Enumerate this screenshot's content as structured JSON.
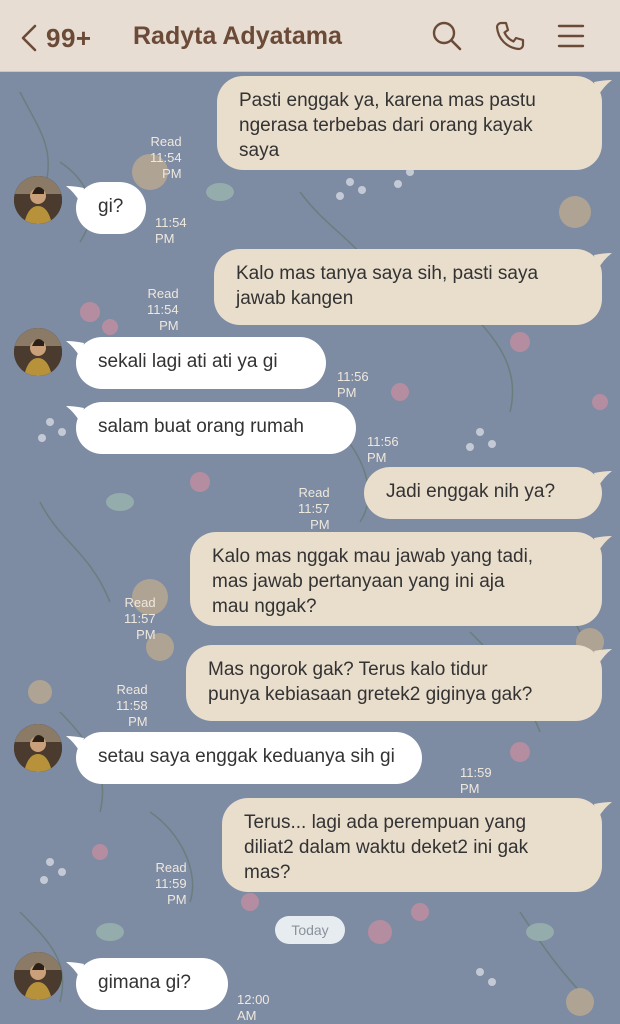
{
  "header": {
    "back_count": "99+",
    "title": "Radyta Adyatama",
    "icons": [
      "chevron-left-icon",
      "search-icon",
      "phone-icon",
      "menu-icon"
    ]
  },
  "messages": [
    {
      "side": "out",
      "lines": [
        "Pasti enggak ya, karena mas pastu",
        "ngerasa terbebas dari orang kayak",
        "saya"
      ],
      "read": "Read",
      "time": "11:54 PM"
    },
    {
      "side": "in",
      "lines": [
        "gi?"
      ],
      "time": "11:54 PM"
    },
    {
      "side": "out",
      "lines": [
        "Kalo mas tanya saya sih, pasti saya",
        "jawab kangen"
      ],
      "read": "Read",
      "time": "11:54 PM"
    },
    {
      "side": "in",
      "lines": [
        "sekali lagi ati ati ya gi"
      ],
      "time": "11:56 PM"
    },
    {
      "side": "in",
      "lines": [
        "salam buat orang rumah"
      ],
      "time": "11:56 PM"
    },
    {
      "side": "out",
      "lines": [
        "Jadi enggak nih ya?"
      ],
      "read": "Read",
      "time": "11:57 PM"
    },
    {
      "side": "out",
      "lines": [
        "Kalo mas nggak mau jawab yang tadi,",
        "mas jawab pertanyaan yang ini aja",
        "mau nggak?"
      ],
      "read": "Read",
      "time": "11:57 PM"
    },
    {
      "side": "out",
      "lines": [
        "Mas ngorok gak? Terus kalo tidur",
        "punya kebiasaan gretek2 giginya gak?"
      ],
      "read": "Read",
      "time": "11:58 PM"
    },
    {
      "side": "in",
      "lines": [
        "setau saya enggak keduanya sih gi"
      ],
      "time": "11:59 PM"
    },
    {
      "side": "out",
      "lines": [
        "Terus... lagi ada perempuan yang",
        "diliat2 dalam waktu deket2 ini gak",
        "mas?"
      ],
      "read": "Read",
      "time": "11:59 PM"
    },
    {
      "side": "in",
      "lines": [
        "gimana gi?"
      ],
      "time": "12:00 AM"
    }
  ],
  "date_separator": "Today",
  "colors": {
    "header_bg": "#e7ddd3",
    "header_text": "#6b4a37",
    "chat_bg": "#7d8ba3",
    "outgoing_bubble": "#e9ddcc",
    "incoming_bubble": "#ffffff"
  }
}
